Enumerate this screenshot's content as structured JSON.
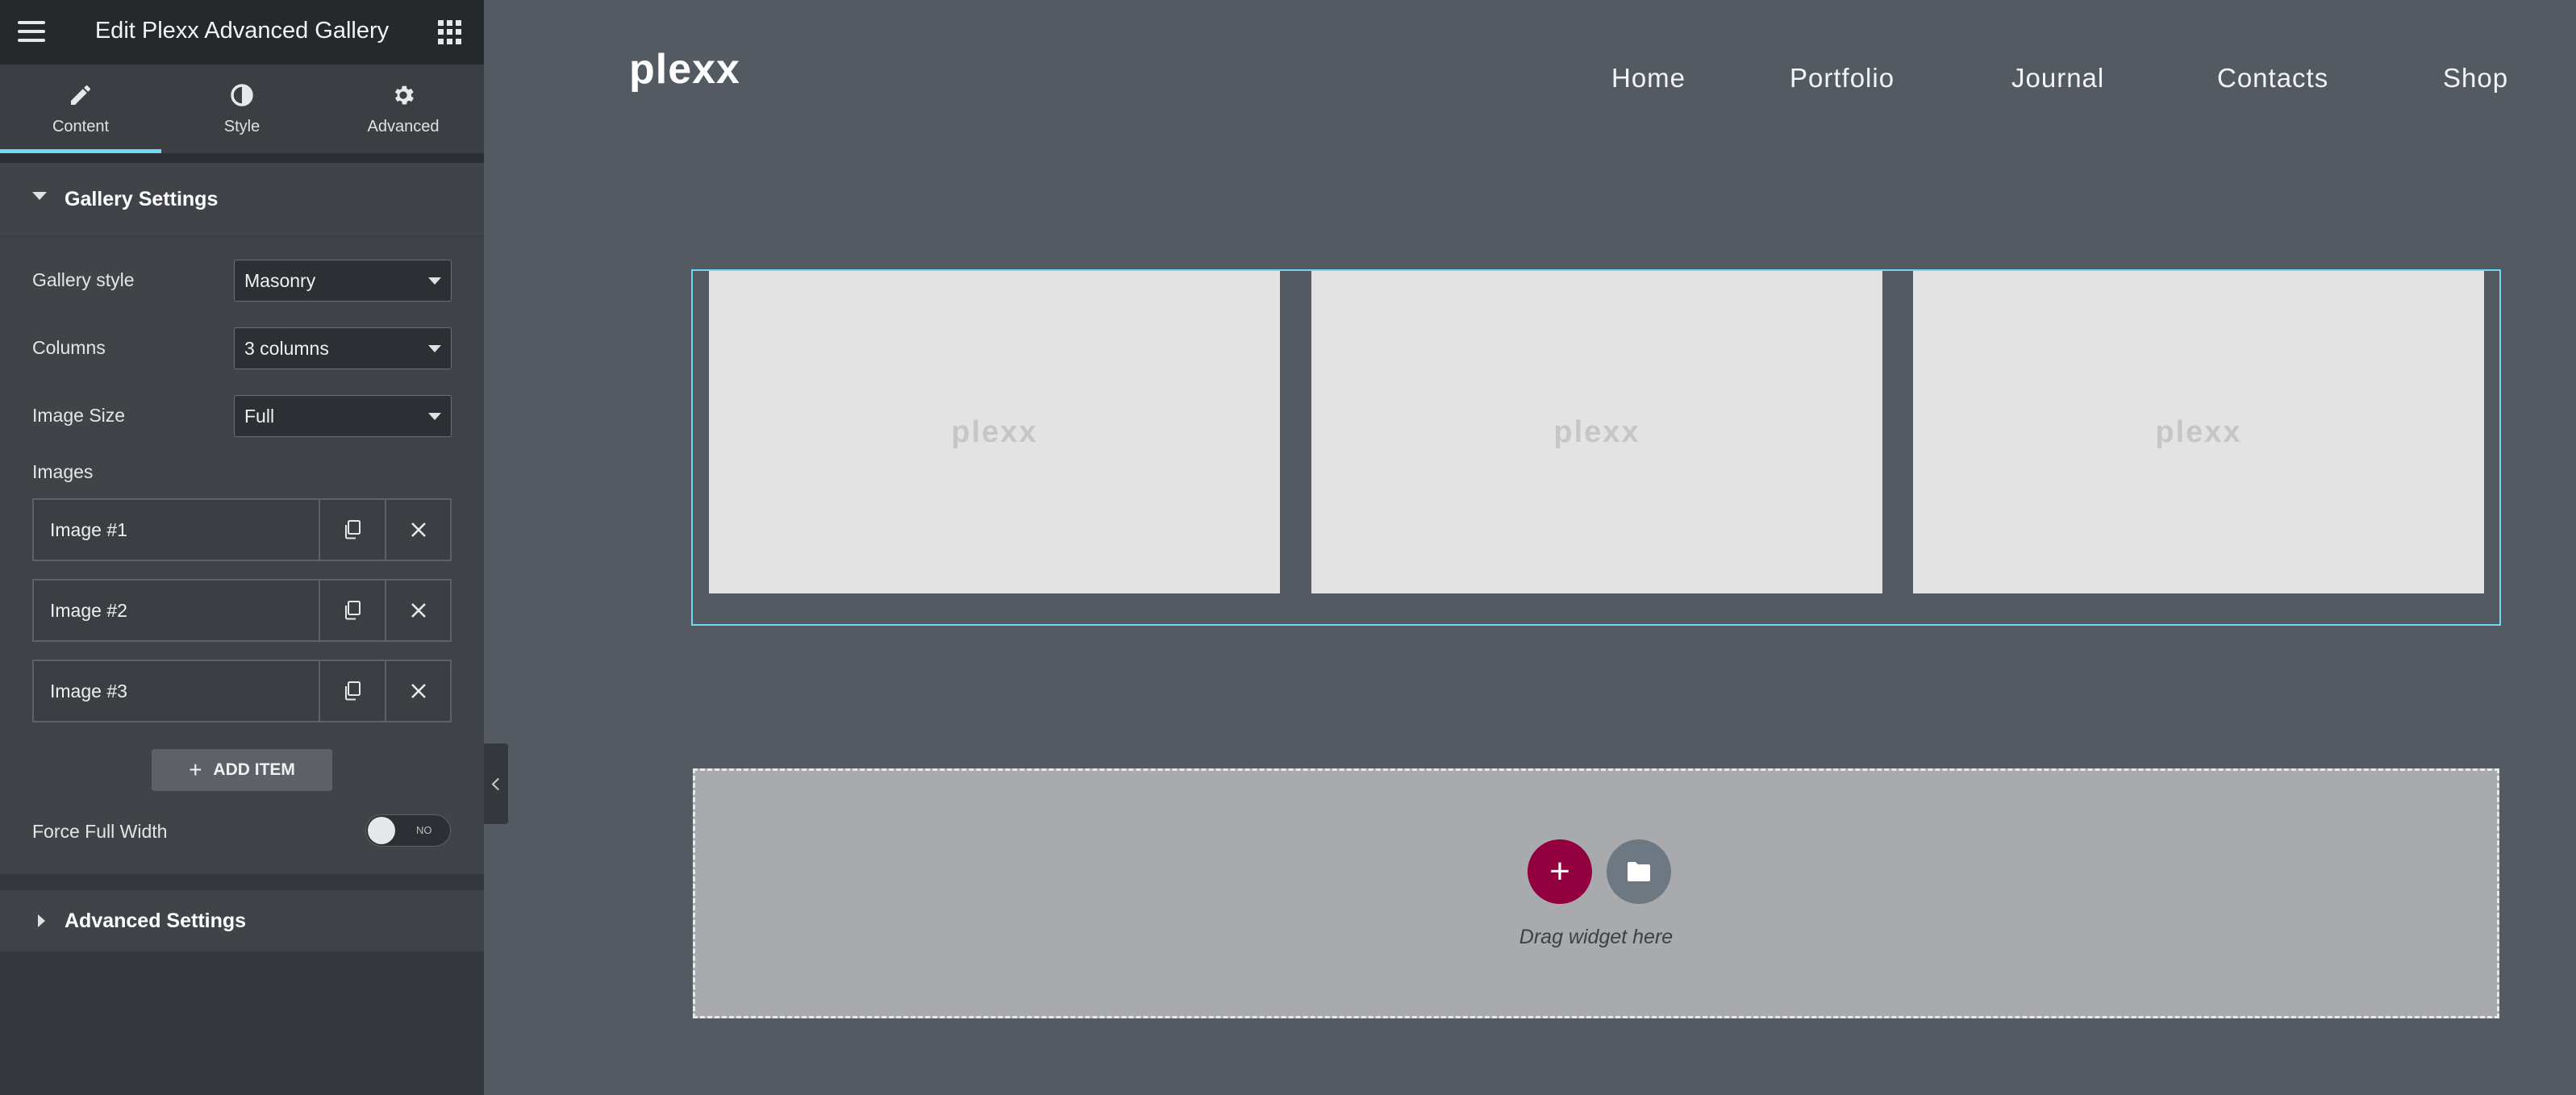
{
  "editor": {
    "title": "Edit Plexx Advanced Gallery",
    "tabs": [
      {
        "label": "Content",
        "icon": "pencil-icon",
        "active": true
      },
      {
        "label": "Style",
        "icon": "half-circle-icon",
        "active": false
      },
      {
        "label": "Advanced",
        "icon": "gear-icon",
        "active": false
      }
    ],
    "gallery_settings": {
      "heading": "Gallery Settings",
      "gallery_style": {
        "label": "Gallery style",
        "value": "Masonry"
      },
      "columns": {
        "label": "Columns",
        "value": "3 columns"
      },
      "image_size": {
        "label": "Image Size",
        "value": "Full"
      },
      "images_label": "Images",
      "images": [
        {
          "label": "Image #1"
        },
        {
          "label": "Image #2"
        },
        {
          "label": "Image #3"
        }
      ],
      "add_item_label": "ADD ITEM",
      "force_full_width": {
        "label": "Force Full Width",
        "state": "NO"
      }
    },
    "advanced_settings": {
      "heading": "Advanced Settings"
    }
  },
  "preview": {
    "logo": "plexx",
    "nav": [
      "Home",
      "Portfolio",
      "Journal",
      "Contacts",
      "Shop"
    ],
    "gallery_placeholder_text": [
      "plexx",
      "plexx",
      "plexx"
    ],
    "dropzone_text": "Drag widget here"
  },
  "colors": {
    "accent": "#71d7f7",
    "add_button": "#93003f",
    "panel": "#34383c",
    "canvas": "#545a62"
  }
}
